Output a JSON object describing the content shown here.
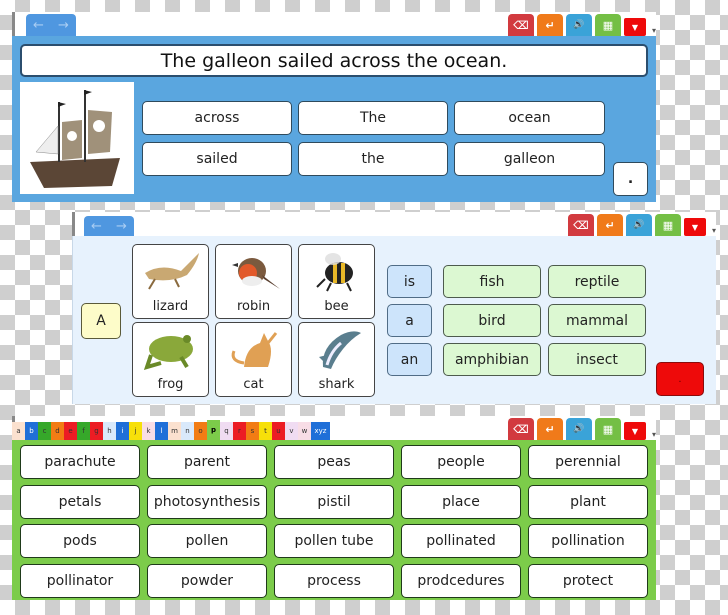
{
  "panel1": {
    "nav": {
      "back": "←",
      "forward": "→"
    },
    "toolbar": [
      {
        "name": "delete",
        "icon": "⌫"
      },
      {
        "name": "enter",
        "icon": "↵"
      },
      {
        "name": "speak",
        "icon": "🔊"
      },
      {
        "name": "keyboard",
        "icon": "▦"
      },
      {
        "name": "minimize",
        "icon": "▼"
      }
    ],
    "sentence": "The galleon sailed across the ocean.",
    "image_alt": "pirate galleon ship",
    "words": [
      "across",
      "The",
      "ocean",
      "sailed",
      "the",
      "galleon"
    ],
    "punctuation": "."
  },
  "panel2": {
    "nav": {
      "back": "←",
      "forward": "→"
    },
    "article_button": "A",
    "animals": [
      "lizard",
      "robin",
      "bee",
      "frog",
      "cat",
      "shark"
    ],
    "verbs": [
      "is",
      "a",
      "an"
    ],
    "categories": [
      "fish",
      "reptile",
      "bird",
      "mammal",
      "amphibian",
      "insect"
    ],
    "punctuation": ".",
    "colors": {
      "punct_bg": "#ee0a0a",
      "article_bg": "#fdfcc9",
      "verb_bg": "#cde4fb",
      "category_bg": "#dcf8d2"
    }
  },
  "panel3": {
    "alphabet": [
      {
        "l": "a",
        "c": "#fbe1cf"
      },
      {
        "l": "b",
        "c": "#1f6fd8"
      },
      {
        "l": "c",
        "c": "#36a82a"
      },
      {
        "l": "d",
        "c": "#f27c14"
      },
      {
        "l": "e",
        "c": "#ec1c24"
      },
      {
        "l": "f",
        "c": "#36a82a"
      },
      {
        "l": "g",
        "c": "#ec1c24"
      },
      {
        "l": "h",
        "c": "#d9e9fb"
      },
      {
        "l": "i",
        "c": "#1f6fd8"
      },
      {
        "l": "j",
        "c": "#f7e00a"
      },
      {
        "l": "k",
        "c": "#f8dde6"
      },
      {
        "l": "l",
        "c": "#1f6fd8"
      },
      {
        "l": "m",
        "c": "#fbe1cf"
      },
      {
        "l": "n",
        "c": "#d9e9fb"
      },
      {
        "l": "o",
        "c": "#f27c14"
      },
      {
        "l": "p",
        "c": "#7ccc4a"
      },
      {
        "l": "q",
        "c": "#f0dcf2"
      },
      {
        "l": "r",
        "c": "#ec1c24"
      },
      {
        "l": "s",
        "c": "#f27c14"
      },
      {
        "l": "t",
        "c": "#f7e00a"
      },
      {
        "l": "u",
        "c": "#ec1c24"
      },
      {
        "l": "v",
        "c": "#f0dcf2"
      },
      {
        "l": "w",
        "c": "#f8dde6"
      },
      {
        "l": "xyz",
        "c": "#1f6fd8"
      }
    ],
    "selected_letter": "p",
    "words": [
      "parachute",
      "parent",
      "peas",
      "people",
      "perennial",
      "petals",
      "photosynthesis",
      "pistil",
      "place",
      "plant",
      "pods",
      "pollen",
      "pollen tube",
      "pollinated",
      "pollination",
      "pollinator",
      "powder",
      "process",
      "prodcedures",
      "protect"
    ]
  }
}
